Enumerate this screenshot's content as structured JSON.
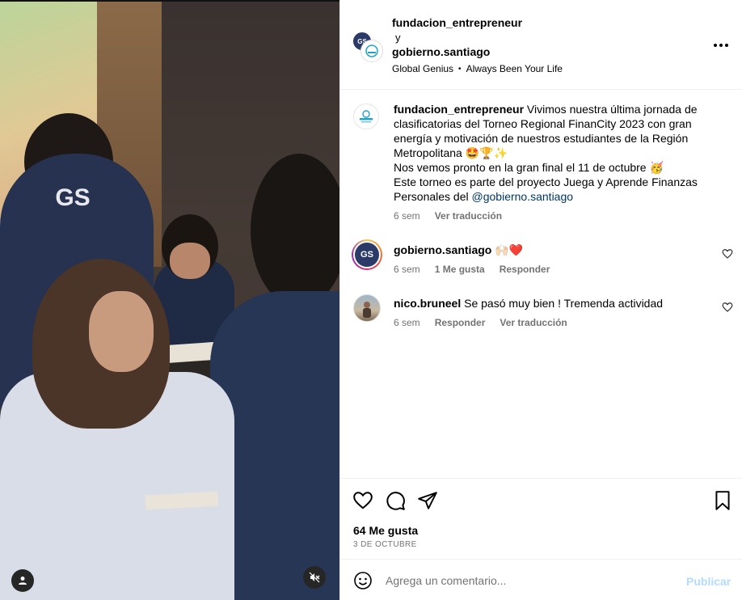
{
  "header": {
    "user1": "fundacion_entrepreneur",
    "conjunction": "y",
    "user2": "gobierno.santiago",
    "audio_artist": "Global Genius",
    "audio_separator": "•",
    "audio_title": "Always Been Your Life"
  },
  "media": {
    "logo_text": "GS"
  },
  "caption": {
    "username": "fundacion_entrepreneur",
    "text_1": "Vivimos nuestra última jornada de clasificatorias del Torneo Regional FinanCity 2023 con gran energía y motivación de nuestros estudiantes de la Región Metropolitana 🤩🏆✨",
    "text_2": "Nos vemos pronto en la gran final el 11 de octubre 🥳",
    "text_3": "Este torneo es parte del proyecto Juega y Aprende Finanzas Personales del ",
    "mention": "@gobierno.santiago",
    "time": "6 sem",
    "translate": "Ver traducción"
  },
  "comments": [
    {
      "username": "gobierno.santiago",
      "text": "🙌🏻❤️",
      "avatar_text": "GS",
      "time": "6 sem",
      "likes": "1 Me gusta",
      "reply": "Responder"
    },
    {
      "username": "nico.bruneel",
      "text": "Se pasó muy bien ! Tremenda actividad",
      "time": "6 sem",
      "reply": "Responder",
      "translate": "Ver traducción"
    }
  ],
  "actions": {
    "likes": "64 Me gusta",
    "date": "3 DE OCTUBRE"
  },
  "comment_box": {
    "placeholder": "Agrega un comentario...",
    "publish": "Publicar"
  }
}
